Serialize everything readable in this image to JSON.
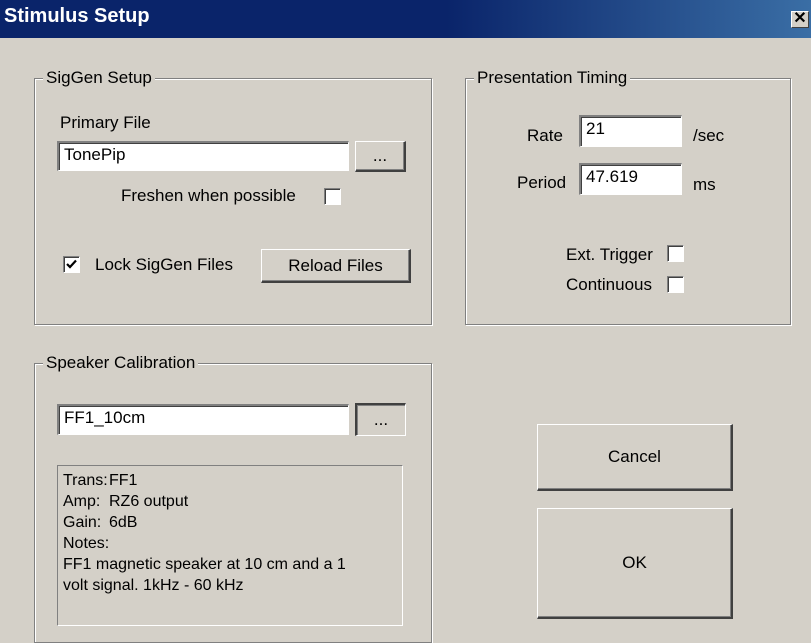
{
  "window": {
    "title": "Stimulus Setup",
    "close_glyph": "✕"
  },
  "siggen": {
    "group_label": "SigGen Setup",
    "primary_file_label": "Primary File",
    "primary_file_value": "TonePip",
    "browse_label": "...",
    "freshen_label": "Freshen when possible",
    "freshen_checked": false,
    "lock_label": "Lock SigGen Files",
    "lock_checked": true,
    "reload_label": "Reload Files"
  },
  "timing": {
    "group_label": "Presentation Timing",
    "rate_label": "Rate",
    "rate_value": "21",
    "rate_unit": "/sec",
    "period_label": "Period",
    "period_value": "47.619",
    "period_unit": "ms",
    "ext_trigger_label": "Ext. Trigger",
    "ext_trigger_checked": false,
    "continuous_label": "Continuous",
    "continuous_checked": false
  },
  "calibration": {
    "group_label": "Speaker Calibration",
    "file_value": "FF1_10cm",
    "browse_label": "...",
    "info": {
      "trans_key": "Trans:",
      "trans_val": "FF1",
      "amp_key": "Amp:",
      "amp_val": "RZ6 output",
      "gain_key": "Gain:",
      "gain_val": "6dB",
      "notes_key": "Notes:",
      "notes_line1": "FF1 magnetic speaker at 10 cm and a 1",
      "notes_line2": "volt signal. 1kHz - 60 kHz"
    }
  },
  "actions": {
    "cancel_label": "Cancel",
    "ok_label": "OK"
  },
  "icons": {
    "close": "close-icon",
    "check": "checkmark-icon"
  },
  "colors": {
    "titlebar": "#0a246a",
    "face": "#d4d0c8"
  }
}
